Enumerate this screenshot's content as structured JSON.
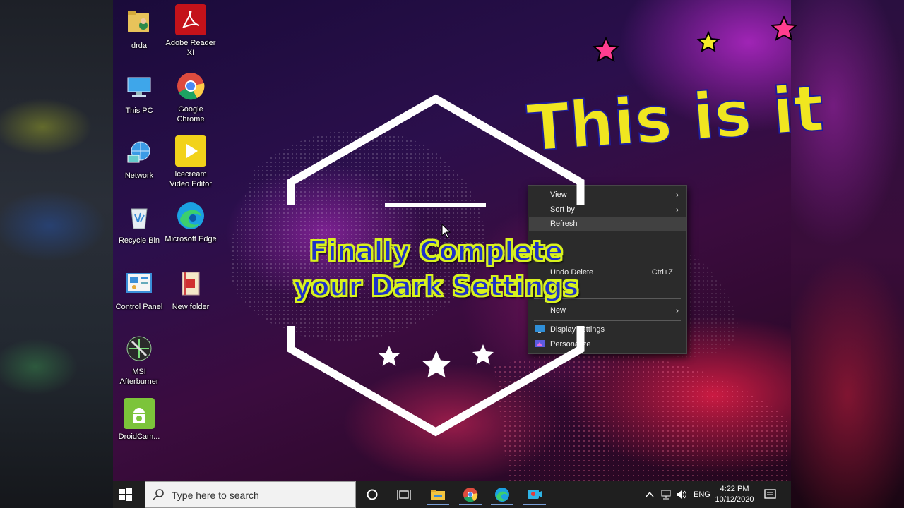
{
  "desktop": {
    "icons": [
      {
        "label": "drda"
      },
      {
        "label": "Adobe Reader XI"
      },
      {
        "label": "This PC"
      },
      {
        "label": "Google Chrome"
      },
      {
        "label": "Network"
      },
      {
        "label": "Icecream Video Editor"
      },
      {
        "label": "Recycle Bin"
      },
      {
        "label": "Microsoft Edge"
      },
      {
        "label": "Control Panel"
      },
      {
        "label": "New folder"
      },
      {
        "label": "MSI Afterburner"
      },
      {
        "label": "DroidCam..."
      }
    ]
  },
  "context_menu": {
    "view": "View",
    "sort_by": "Sort by",
    "refresh": "Refresh",
    "undo_delete": "Undo Delete",
    "undo_shortcut": "Ctrl+Z",
    "new": "New",
    "display_settings": "Display settings",
    "personalize": "Personalize"
  },
  "overlay": {
    "headline_line1": "Finally Complete",
    "headline_line2": "your Dark Settings",
    "sticker": "This is it"
  },
  "taskbar": {
    "search_placeholder": "Type here to search",
    "language": "ENG",
    "time": "4:22 PM",
    "date": "10/12/2020"
  }
}
